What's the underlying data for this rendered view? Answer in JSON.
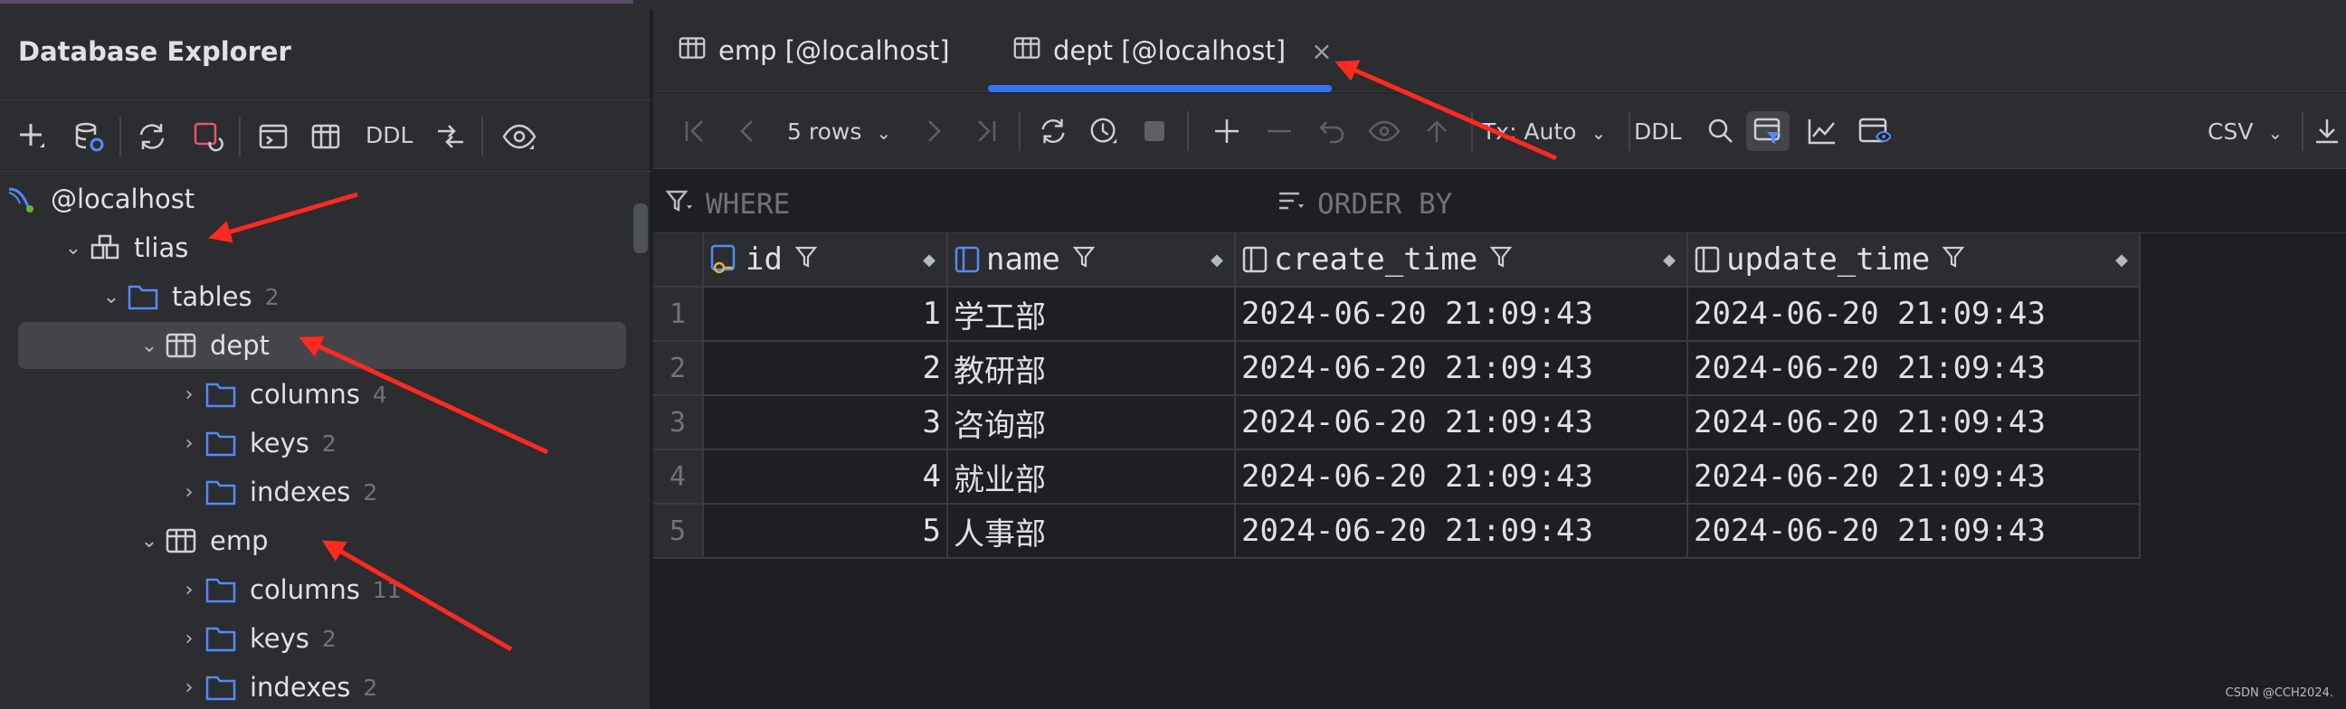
{
  "explorer": {
    "title": "Database Explorer",
    "toolbar": {
      "ddl_label": "DDL"
    },
    "tree": {
      "connection": "@localhost",
      "schema": "tlias",
      "tables_label": "tables",
      "tables_count": "2",
      "dept": {
        "label": "dept",
        "columns_label": "columns",
        "columns_count": "4",
        "keys_label": "keys",
        "keys_count": "2",
        "indexes_label": "indexes",
        "indexes_count": "2"
      },
      "emp": {
        "label": "emp",
        "columns_label": "columns",
        "columns_count": "11",
        "keys_label": "keys",
        "keys_count": "2",
        "indexes_label": "indexes",
        "indexes_count": "2"
      }
    }
  },
  "tabs": [
    {
      "label": "emp [@localhost]"
    },
    {
      "label": "dept [@localhost]"
    }
  ],
  "grid_toolbar": {
    "rows_label": "5 rows",
    "tx_label": "Tx: Auto",
    "ddl_label": "DDL",
    "export_label": "CSV"
  },
  "filter": {
    "where": "WHERE",
    "order_by": "ORDER BY"
  },
  "table": {
    "columns": [
      "id",
      "name",
      "create_time",
      "update_time"
    ],
    "rows": [
      {
        "n": "1",
        "id": "1",
        "name": "学工部",
        "create_time": "2024-06-20 21:09:43",
        "update_time": "2024-06-20 21:09:43"
      },
      {
        "n": "2",
        "id": "2",
        "name": "教研部",
        "create_time": "2024-06-20 21:09:43",
        "update_time": "2024-06-20 21:09:43"
      },
      {
        "n": "3",
        "id": "3",
        "name": "咨询部",
        "create_time": "2024-06-20 21:09:43",
        "update_time": "2024-06-20 21:09:43"
      },
      {
        "n": "4",
        "id": "4",
        "name": "就业部",
        "create_time": "2024-06-20 21:09:43",
        "update_time": "2024-06-20 21:09:43"
      },
      {
        "n": "5",
        "id": "5",
        "name": "人事部",
        "create_time": "2024-06-20 21:09:43",
        "update_time": "2024-06-20 21:09:43"
      }
    ]
  },
  "watermark": "CSDN @CCH2024.",
  "colors": {
    "folder": "#548af7",
    "accent": "#3574f0",
    "annotation_arrow": "#ff2a1f",
    "connection_dot": "#5fb832"
  }
}
